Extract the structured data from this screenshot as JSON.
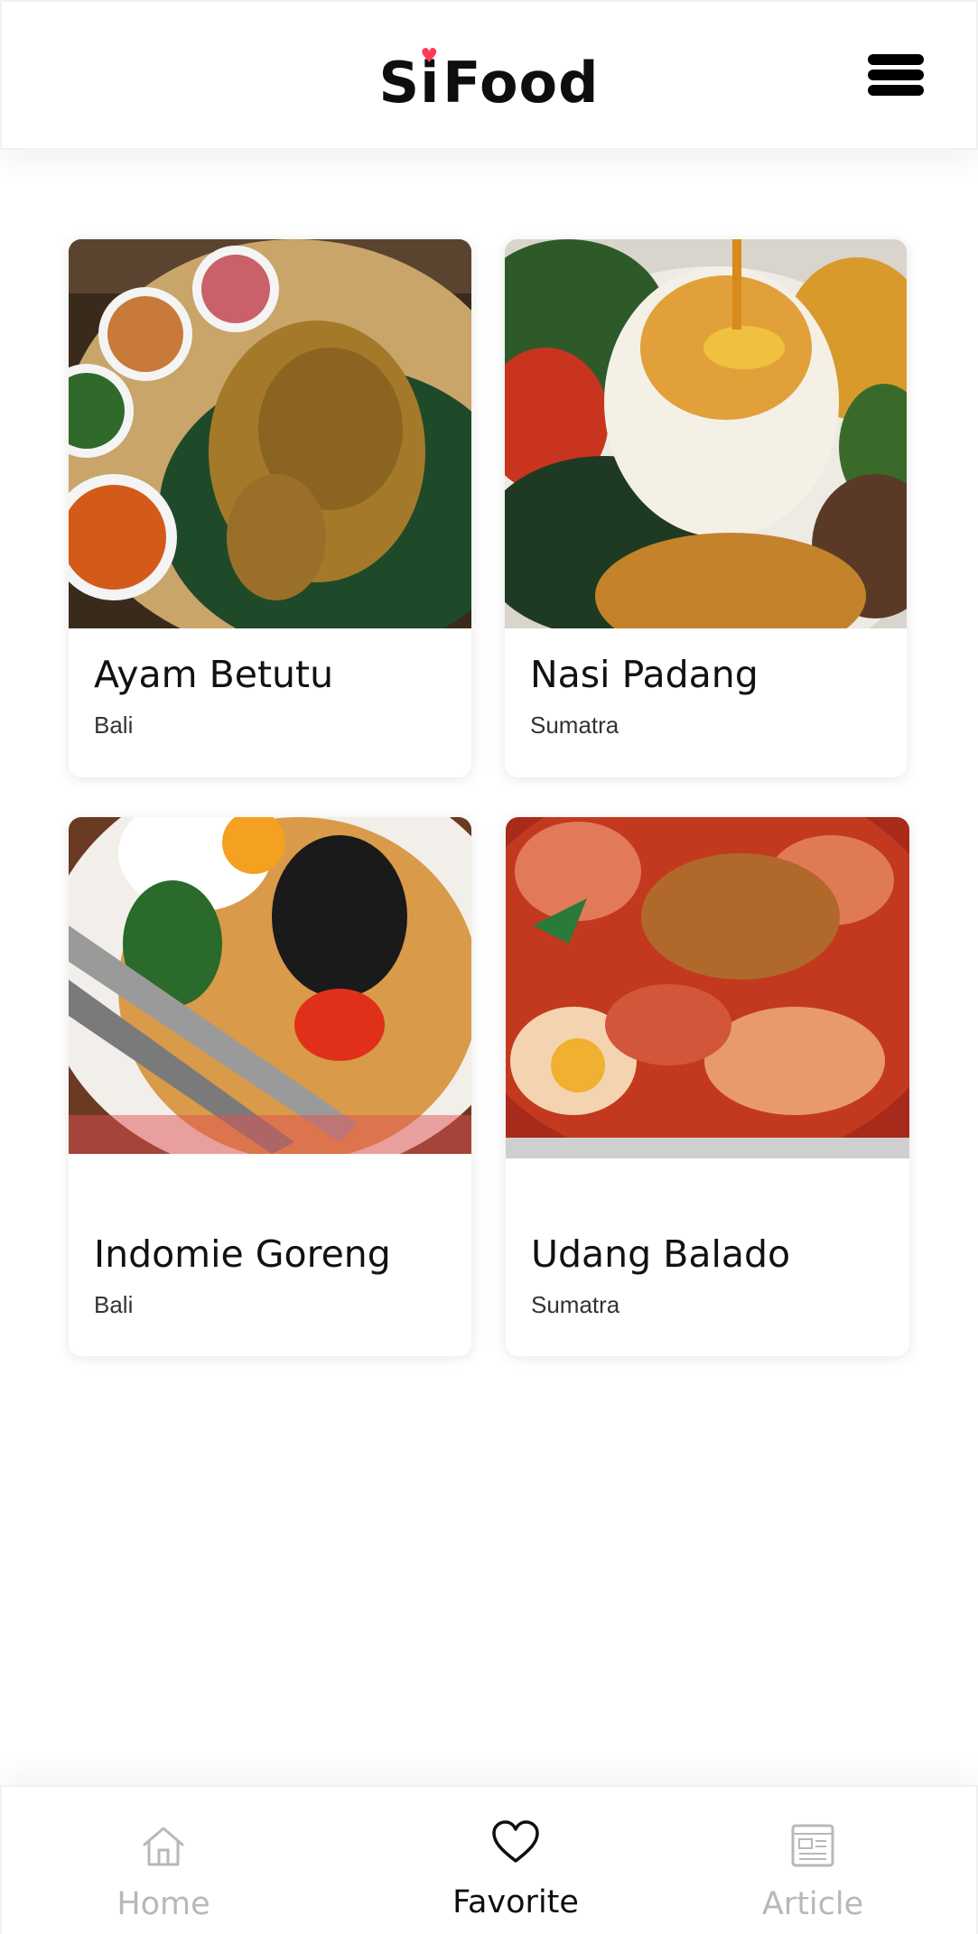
{
  "app": {
    "logo_text_pre": "Si",
    "logo_text_post": "Food",
    "accent_color": "#ff3b57",
    "menu_icon": "hamburger-menu-icon"
  },
  "favorites": [
    {
      "name": "Ayam Betutu",
      "region": "Bali",
      "image": "ayam-betutu-photo"
    },
    {
      "name": "Nasi Padang",
      "region": "Sumatra",
      "image": "nasi-padang-photo"
    },
    {
      "name": "Indomie Goreng",
      "region": "Bali",
      "image": "indomie-goreng-photo"
    },
    {
      "name": "Udang Balado",
      "region": "Sumatra",
      "image": "udang-balado-photo"
    }
  ],
  "bottom_nav": {
    "active": "Favorite",
    "items": [
      {
        "label": "Home",
        "icon": "home-icon"
      },
      {
        "label": "Favorite",
        "icon": "heart-icon"
      },
      {
        "label": "Article",
        "icon": "article-icon"
      }
    ]
  }
}
